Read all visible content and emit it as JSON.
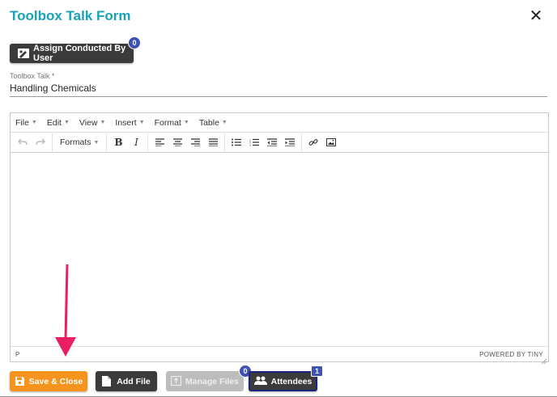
{
  "dialog": {
    "title": "Toolbox Talk Form",
    "close_icon": "close-icon"
  },
  "assign": {
    "label": "Assign Conducted By User",
    "badge": "0",
    "icon": "user-edit-icon"
  },
  "field": {
    "label": "Toolbox Talk *",
    "value": "Handling Chemicals"
  },
  "editor": {
    "menus": [
      "File",
      "Edit",
      "View",
      "Insert",
      "Format",
      "Table"
    ],
    "formats_label": "Formats",
    "status_path": "P",
    "powered_by": "POWERED BY TINY",
    "content": ""
  },
  "footer": {
    "save_label": "Save & Close",
    "add_file_label": "Add File",
    "manage_files_label": "Manage Files",
    "manage_files_badge": "0",
    "attendees_label": "Attendees",
    "attendees_badge": "1"
  },
  "colors": {
    "title": "#17a2b8",
    "save_button": "#f7941d",
    "dark_button": "#3b3b3b",
    "badge": "#3f51b5",
    "annotation_arrow": "#e91e63"
  }
}
